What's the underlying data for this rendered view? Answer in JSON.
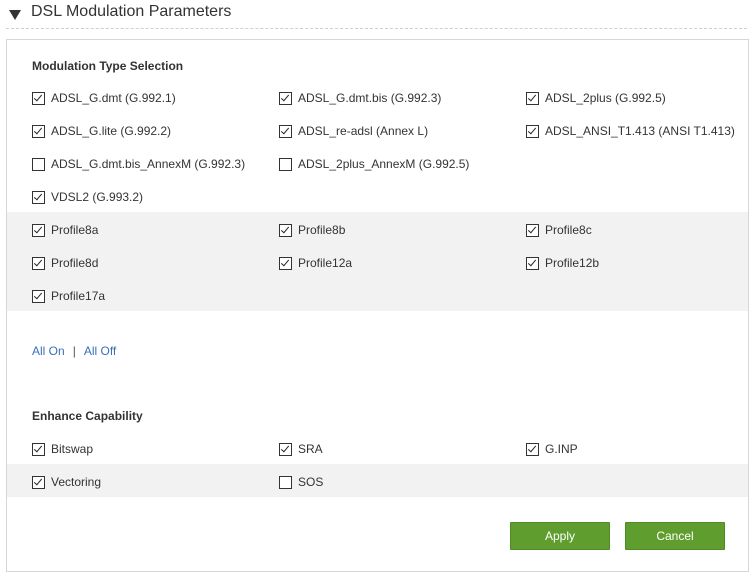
{
  "header": {
    "title": "DSL Modulation Parameters"
  },
  "modulation": {
    "title": "Modulation Type Selection",
    "options": [
      {
        "label": "ADSL_G.dmt (G.992.1)",
        "checked": true
      },
      {
        "label": "ADSL_G.dmt.bis (G.992.3)",
        "checked": true
      },
      {
        "label": "ADSL_2plus (G.992.5)",
        "checked": true
      },
      {
        "label": "ADSL_G.lite (G.992.2)",
        "checked": true
      },
      {
        "label": "ADSL_re-adsl (Annex L)",
        "checked": true
      },
      {
        "label": "ADSL_ANSI_T1.413 (ANSI T1.413)",
        "checked": true
      },
      {
        "label": "ADSL_G.dmt.bis_AnnexM (G.992.3)",
        "checked": false
      },
      {
        "label": "ADSL_2plus_AnnexM (G.992.5)",
        "checked": false
      },
      {
        "label": "VDSL2 (G.993.2)",
        "checked": true
      }
    ]
  },
  "profiles": {
    "options": [
      {
        "label": "Profile8a",
        "checked": true
      },
      {
        "label": "Profile8b",
        "checked": true
      },
      {
        "label": "Profile8c",
        "checked": true
      },
      {
        "label": "Profile8d",
        "checked": true
      },
      {
        "label": "Profile12a",
        "checked": true
      },
      {
        "label": "Profile12b",
        "checked": true
      },
      {
        "label": "Profile17a",
        "checked": true
      }
    ]
  },
  "links": {
    "all_on": "All On",
    "separator": "|",
    "all_off": "All Off"
  },
  "enhance": {
    "title": "Enhance Capability",
    "options": [
      {
        "label": "Bitswap",
        "checked": true
      },
      {
        "label": "SRA",
        "checked": true
      },
      {
        "label": "G.INP",
        "checked": true
      },
      {
        "label": "Vectoring",
        "checked": true
      },
      {
        "label": "SOS",
        "checked": false
      }
    ]
  },
  "buttons": {
    "apply": "Apply",
    "cancel": "Cancel"
  },
  "colors": {
    "button_green": "#5f9e2e",
    "link_blue": "#3a6fb5",
    "band_gray": "#f2f2f2"
  }
}
